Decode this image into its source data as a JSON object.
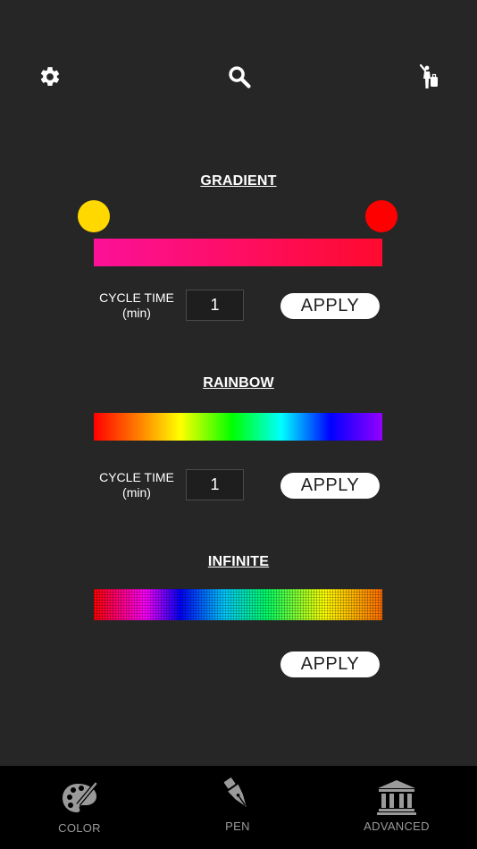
{
  "toolbar": {
    "left_icon": "gear-icon",
    "center_icon": "search-icon",
    "right_icon": "person-luggage-icon"
  },
  "gradient": {
    "title": "GRADIENT",
    "start_color": "#fc1199",
    "end_color": "#ff0a2e",
    "left_knob_color": "#ffd800",
    "right_knob_color": "#ff0000",
    "cycle_label_line1": "CYCLE TIME",
    "cycle_label_line2": "(min)",
    "cycle_value": "1",
    "apply_label": "APPLY"
  },
  "rainbow": {
    "title": "RAINBOW",
    "cycle_label_line1": "CYCLE TIME",
    "cycle_label_line2": "(min)",
    "cycle_value": "1",
    "apply_label": "APPLY"
  },
  "infinite": {
    "title": "INFINITE",
    "apply_label": "APPLY"
  },
  "bottom_nav": {
    "items": [
      {
        "label": "COLOR",
        "icon": "palette-icon"
      },
      {
        "label": "PEN",
        "icon": "pen-nib-icon"
      },
      {
        "label": "ADVANCED",
        "icon": "temple-icon"
      }
    ]
  }
}
